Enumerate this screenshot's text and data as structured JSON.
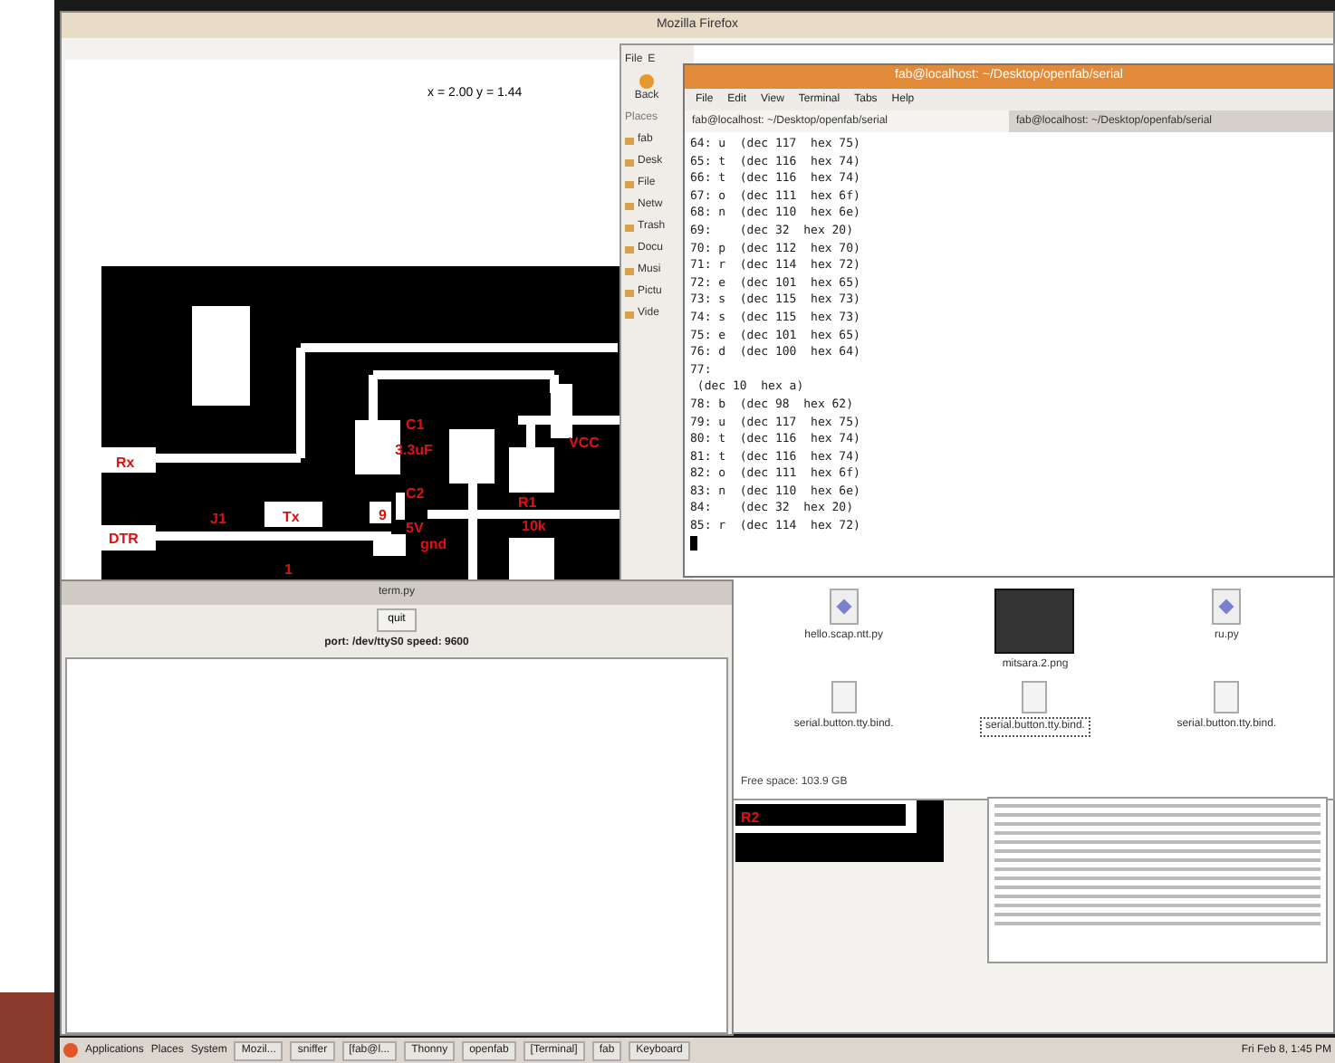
{
  "browser_window": {
    "title": "Mozilla Firefox",
    "coordinates": "x = 2.00  y = 1.44"
  },
  "board_labels": [
    "Rx",
    "Tx",
    "DTR",
    "J1",
    "C1",
    "3.3uF",
    "VCC",
    "9",
    "C2",
    "5V",
    "gnd",
    "R1",
    "10k",
    "1"
  ],
  "lower_board_label": "R2",
  "file_manager": {
    "menu": [
      "File",
      "E"
    ],
    "back": "Back",
    "places_heading": "Places",
    "places": [
      "fab",
      "Desk",
      "File",
      "Netw",
      "Trash",
      "Docu",
      "Musi",
      "Pictu",
      "Vide"
    ],
    "files": [
      {
        "name": "hello.scap.ntt.py",
        "kind": "script",
        "selected": false
      },
      {
        "name": "mitsara.2.png",
        "kind": "image",
        "selected": false
      },
      {
        "name": "ru.py",
        "kind": "script",
        "selected": false
      },
      {
        "name": "serial.button.tty.bind.",
        "kind": "text",
        "selected": false
      },
      {
        "name": "serial.button.tty.bind.",
        "kind": "text",
        "selected": true
      },
      {
        "name": "serial.button.tty.bind.",
        "kind": "text",
        "selected": false
      }
    ],
    "status": "Free space: 103.9 GB"
  },
  "terminal": {
    "title": "fab@localhost: ~/Desktop/openfab/serial",
    "menu": [
      "File",
      "Edit",
      "View",
      "Terminal",
      "Tabs",
      "Help"
    ],
    "tabs": [
      {
        "label": "fab@localhost: ~/Desktop/openfab/serial",
        "selected": true
      },
      {
        "label": "fab@localhost: ~/Desktop/openfab/serial",
        "selected": false
      }
    ],
    "lines": [
      "64: u  (dec 117  hex 75)",
      "65: t  (dec 116  hex 74)",
      "66: t  (dec 116  hex 74)",
      "67: o  (dec 111  hex 6f)",
      "68: n  (dec 110  hex 6e)",
      "69:    (dec 32  hex 20)",
      "70: p  (dec 112  hex 70)",
      "71: r  (dec 114  hex 72)",
      "72: e  (dec 101  hex 65)",
      "73: s  (dec 115  hex 73)",
      "74: s  (dec 115  hex 73)",
      "75: e  (dec 101  hex 65)",
      "76: d  (dec 100  hex 64)",
      "77:",
      " (dec 10  hex a)",
      "78: b  (dec 98  hex 62)",
      "79: u  (dec 117  hex 75)",
      "80: t  (dec 116  hex 74)",
      "81: t  (dec 116  hex 74)",
      "82: o  (dec 111  hex 6f)",
      "83: n  (dec 110  hex 6e)",
      "84:    (dec 32  hex 20)",
      "85: r  (dec 114  hex 72)"
    ]
  },
  "serial_window": {
    "title": "term.py",
    "button": "quit",
    "info": "port: /dev/ttyS0    speed: 9600"
  },
  "taskbar": {
    "menus": [
      "Applications",
      "Places",
      "System"
    ],
    "tasks": [
      "Mozil...",
      "sniffer",
      "[fab@l...",
      "Thonny",
      "openfab",
      "[Terminal]",
      "fab",
      "Keyboard"
    ],
    "clock": "Fri Feb 8, 1:45 PM"
  }
}
